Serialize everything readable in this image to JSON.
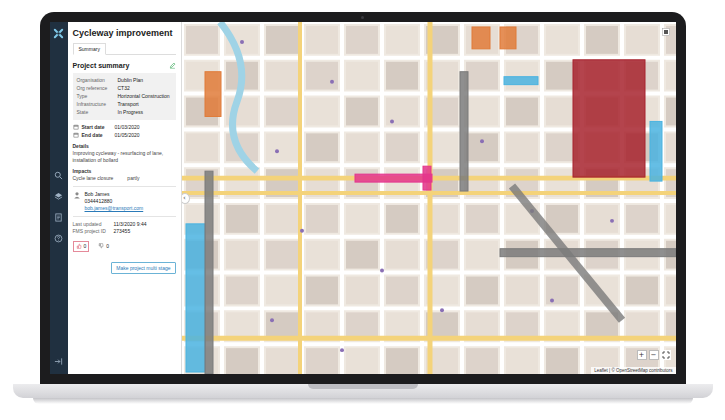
{
  "app": {
    "title": "Cycleway improvement"
  },
  "nav": {
    "items": [
      {
        "kind": "search",
        "selected": false
      },
      {
        "kind": "layers",
        "selected": false
      },
      {
        "kind": "document",
        "selected": false
      },
      {
        "kind": "help",
        "selected": false
      }
    ]
  },
  "tabs": [
    {
      "label": "Summary",
      "selected": true
    }
  ],
  "summary": {
    "heading": "Project summary",
    "fields": [
      {
        "label": "Organisation",
        "value": "Dublin Plan"
      },
      {
        "label": "Org reference",
        "value": "CT32"
      },
      {
        "label": "Type",
        "value": "Horizontal Construction"
      },
      {
        "label": "Infrastructure",
        "value": "Transport"
      },
      {
        "label": "State",
        "value": "In Progress"
      }
    ],
    "dates": [
      {
        "label": "Start date",
        "value": "01/03/2020"
      },
      {
        "label": "End date",
        "value": "01/05/2020"
      }
    ],
    "details": {
      "label": "Details",
      "text": "Improving cycleway - resurfacing of lane, installation of bollard"
    },
    "impacts": {
      "label": "Impacts",
      "items": [
        {
          "name": "Cycle lane closure",
          "value": "partly"
        }
      ]
    },
    "contact": {
      "name": "Bob James",
      "phone": "0344412880",
      "email": "bob.james@transport.com"
    },
    "meta": [
      {
        "label": "Last updated",
        "value": "11/3/2020 9:44"
      },
      {
        "label": "FMS project ID",
        "value": "273455"
      }
    ],
    "counters": [
      {
        "kind": "like",
        "value": "0",
        "selected": true
      },
      {
        "kind": "dislike",
        "value": "0",
        "selected": false
      }
    ],
    "button": "Make project multi stage"
  },
  "collapse": "‹",
  "map": {
    "zoom": [
      "+",
      "−"
    ],
    "attribution": "Leaflet | © OpenStreetMap contributors",
    "overlays": [
      {
        "color": "#e4358c"
      },
      {
        "color": "#a7232e"
      },
      {
        "color": "#4ab3e0"
      },
      {
        "color": "#4ab3e0"
      },
      {
        "color": "#4ab3e0"
      },
      {
        "color": "#7b7b7b"
      },
      {
        "color": "#7b7b7b"
      },
      {
        "color": "#7b7b7b"
      },
      {
        "color": "#e07b39"
      },
      {
        "color": "#e07b39"
      },
      {
        "color": "#e07b39"
      },
      {
        "color": "#7b7b7b"
      }
    ]
  }
}
